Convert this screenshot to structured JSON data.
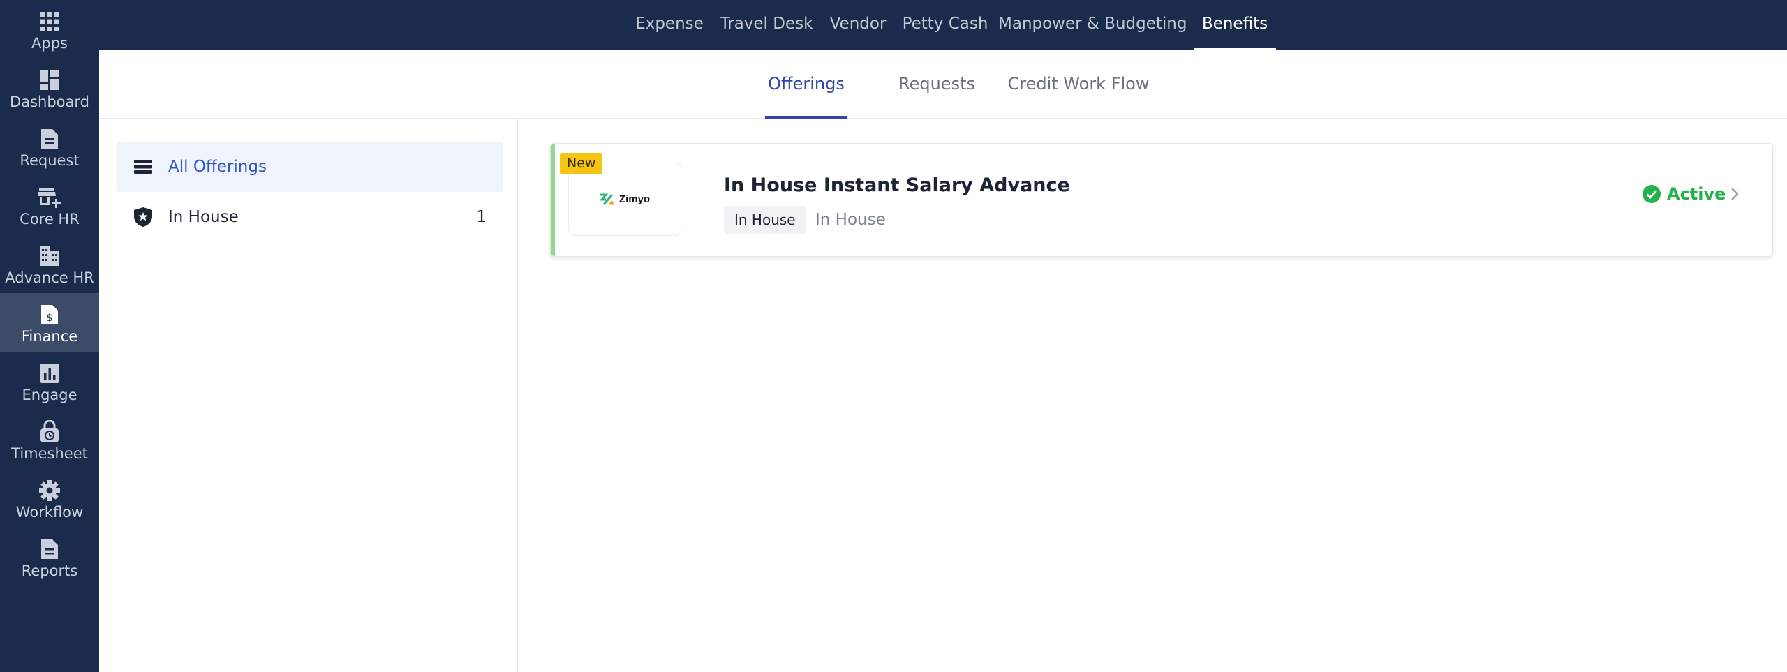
{
  "sidebar": {
    "items": [
      {
        "label": "Apps",
        "icon": "grid-icon"
      },
      {
        "label": "Dashboard",
        "icon": "dashboard-icon"
      },
      {
        "label": "Request",
        "icon": "document-icon"
      },
      {
        "label": "Core HR",
        "icon": "store-add-icon"
      },
      {
        "label": "Advance HR",
        "icon": "building-icon"
      },
      {
        "label": "Finance",
        "icon": "invoice-dollar-icon",
        "active": true
      },
      {
        "label": "Engage",
        "icon": "bar-chart-icon"
      },
      {
        "label": "Timesheet",
        "icon": "lock-clock-icon"
      },
      {
        "label": "Workflow",
        "icon": "gear-icon"
      },
      {
        "label": "Reports",
        "icon": "report-icon"
      }
    ]
  },
  "topnav": {
    "items": [
      "Expense",
      "Travel Desk",
      "Vendor",
      "Petty Cash",
      "Manpower & Budgeting",
      "Benefits"
    ],
    "active": "Benefits"
  },
  "subtabs": {
    "items": [
      "Offerings",
      "Requests",
      "Credit Work Flow"
    ],
    "active": "Offerings"
  },
  "categories": {
    "all": {
      "label": "All Offerings",
      "icon": "list-icon"
    },
    "in_house": {
      "label": "In House",
      "count": "1",
      "icon": "shield-star-icon"
    }
  },
  "offering": {
    "badge": "New",
    "logo_text": "Zimyo",
    "title": "In House Instant Salary Advance",
    "chip": "In House",
    "subtitle": "In House",
    "status": "Active"
  },
  "colors": {
    "nav_bg": "#1a2b4b",
    "accent_blue": "#3245a8",
    "active_green": "#22b14c",
    "badge_yellow": "#f6c511"
  }
}
